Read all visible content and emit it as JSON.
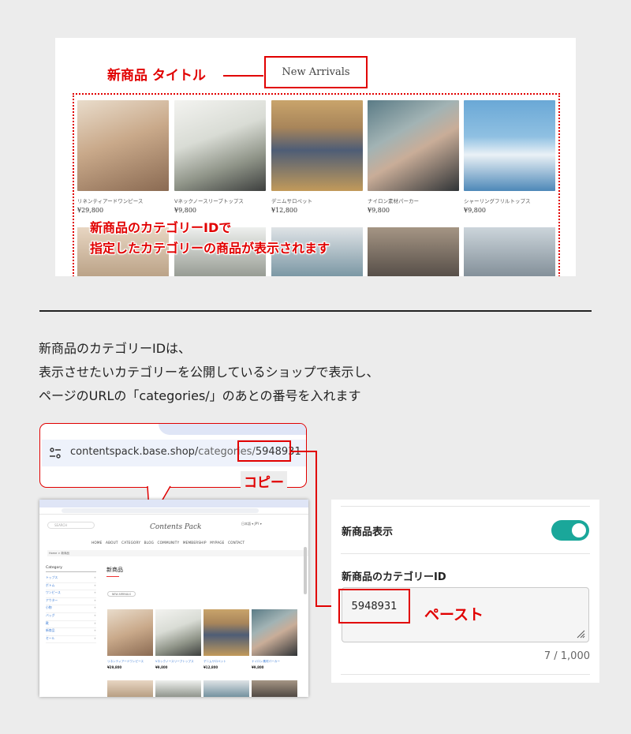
{
  "preview": {
    "title_label": "新商品 タイトル",
    "title_value": "New Arrivals",
    "caption_line1": "新商品のカテゴリーIDで",
    "caption_line2": "指定したカテゴリーの商品が表示されます",
    "products": [
      {
        "name": "リネンティアードワンピース",
        "price": "¥29,800"
      },
      {
        "name": "Vネックノースリーブトップス",
        "price": "¥9,800"
      },
      {
        "name": "デニムサロペット",
        "price": "¥12,800"
      },
      {
        "name": "ナイロン素材パーカー",
        "price": "¥9,800"
      },
      {
        "name": "シャーリングフリルトップス",
        "price": "¥9,800"
      }
    ]
  },
  "description": {
    "line1": "新商品のカテゴリーIDは、",
    "line2": "表示させたいカテゴリーを公開しているショップで表示し、",
    "line3": "ページのURLの「categories/」のあとの番号を入れます"
  },
  "url_bubble": {
    "url_host": "contentspack.base.shop/",
    "url_path": "categories/",
    "category_id": "5948931",
    "copy_label": "コピー"
  },
  "browser": {
    "search_placeholder": "SEARCH",
    "logo": "Contents Pack",
    "lang": "日本語     ▾  JPY   ▾",
    "nav": [
      "HOME",
      "ABOUT",
      "CATEGORY",
      "BLOG",
      "COMMUNITY",
      "MEMBERSHIP",
      "MYPAGE",
      "CONTACT"
    ],
    "breadcrumb": "Home > 新商品",
    "sidebar_heading": "Category",
    "sidebar_items": [
      "トップス",
      "ボトム",
      "ワンピース",
      "アウター",
      "小物",
      "バッグ",
      "靴",
      "新商品",
      "セール"
    ],
    "page_title": "新商品",
    "tag": "NEW ARRIVALS",
    "products": [
      {
        "name": "リネンティアードワンピース",
        "price": "¥29,800"
      },
      {
        "name": "Vネックノースリーブトップス",
        "price": "¥9,800"
      },
      {
        "name": "デニムサロペット",
        "price": "¥12,800"
      },
      {
        "name": "ナイロン素材パーカー",
        "price": "¥9,800"
      }
    ]
  },
  "settings": {
    "new_products_label": "新商品表示",
    "toggle_on": true,
    "category_id_label": "新商品のカテゴリーID",
    "category_id_value": "5948931",
    "counter": "7 / 1,000",
    "paste_label": "ペースト"
  },
  "colors": {
    "accent_red": "#e10000",
    "toggle_teal": "#1aa79a",
    "link_blue": "#3a7bd5"
  }
}
